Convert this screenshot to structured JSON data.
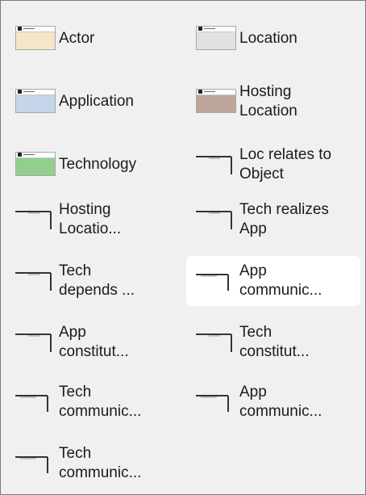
{
  "palette": {
    "items": [
      {
        "label": "Actor",
        "type": "box",
        "fill": "#f5e6c8"
      },
      {
        "label": "Location",
        "type": "box",
        "fill": "#e1e1e1"
      },
      {
        "label": "Application",
        "type": "box",
        "fill": "#c5d6ea"
      },
      {
        "label": "Hosting\nLocation",
        "type": "box",
        "fill": "#bca59a"
      },
      {
        "label": "Technology",
        "type": "box",
        "fill": "#92cf8f"
      },
      {
        "label": "Loc relates to\nObject",
        "type": "connector"
      },
      {
        "label": "Hosting\nLocatio...",
        "type": "connector"
      },
      {
        "label": "Tech realizes\nApp",
        "type": "connector"
      },
      {
        "label": "Tech\ndepends ...",
        "type": "connector"
      },
      {
        "label": "App\ncommunic...",
        "type": "connector",
        "selected": true
      },
      {
        "label": "App\nconstitut...",
        "type": "connector"
      },
      {
        "label": "Tech\nconstitut...",
        "type": "connector"
      },
      {
        "label": "Tech\ncommunic...",
        "type": "connector"
      },
      {
        "label": "App\ncommunic...",
        "type": "connector"
      },
      {
        "label": "Tech\ncommunic...",
        "type": "connector"
      }
    ]
  },
  "colors": {
    "panel_bg": "#f0f0f0",
    "panel_border": "#7a7a7a",
    "selected_bg": "#ffffff"
  }
}
